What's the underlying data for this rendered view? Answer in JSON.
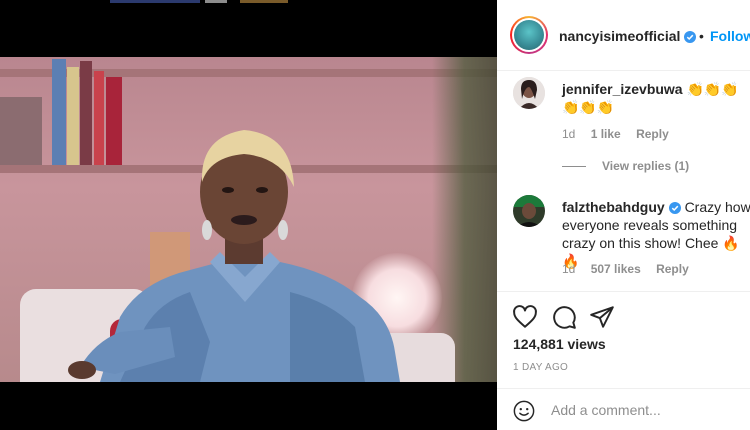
{
  "post": {
    "author": "nancyisimeofficial",
    "follow_label": "Follow",
    "separator": "•",
    "views": "124,881 views",
    "time_ago": "1 DAY AGO"
  },
  "comments": [
    {
      "username": "jennifer_izevbuwa",
      "text": "👏👏👏👏👏👏",
      "time": "1d",
      "likes": "1 like",
      "reply_label": "Reply",
      "view_replies": "View replies (1)"
    },
    {
      "username": "falzthebahdguy",
      "verified": true,
      "text": "Crazy how everyone reveals something crazy on this show! Chee 🔥🔥",
      "time": "1d",
      "likes": "507 likes",
      "reply_label": "Reply"
    }
  ],
  "add_comment": {
    "placeholder": "Add a comment..."
  },
  "icons": {
    "like": "heart-icon",
    "comment": "comment-icon",
    "share": "paper-plane-icon",
    "mute": "muted-speaker-icon",
    "verified": "verified-badge-icon",
    "emoji": "smiley-icon"
  },
  "colors": {
    "link": "#0095f6",
    "text": "#262626",
    "muted": "#8e8e8e",
    "verified": "#3897f0"
  }
}
